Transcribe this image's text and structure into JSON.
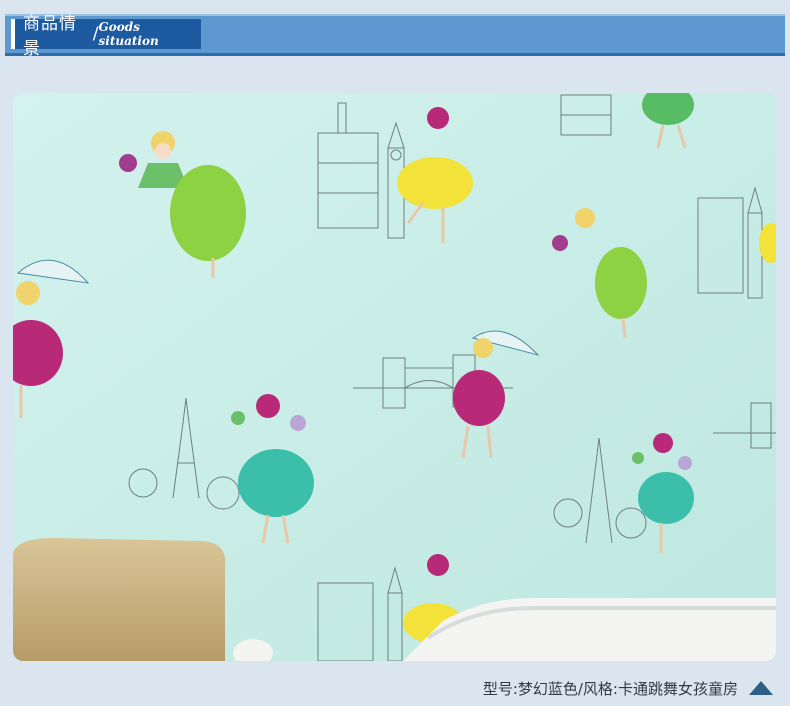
{
  "header": {
    "title_cn": "商品情景",
    "separator": "/",
    "title_en": "Goods situation"
  },
  "footer": {
    "caption": "型号:梦幻蓝色/风格:卡通跳舞女孩童房"
  },
  "photo": {
    "subject": "wallpaper-photo"
  },
  "colors": {
    "header_bar": "#5e98d0",
    "header_label_bg": "#1e5aa0",
    "wall_bg": "#cbeee6",
    "arrow": "#2f5f86"
  },
  "icons": {
    "scroll_top": "triangle-up-icon"
  }
}
